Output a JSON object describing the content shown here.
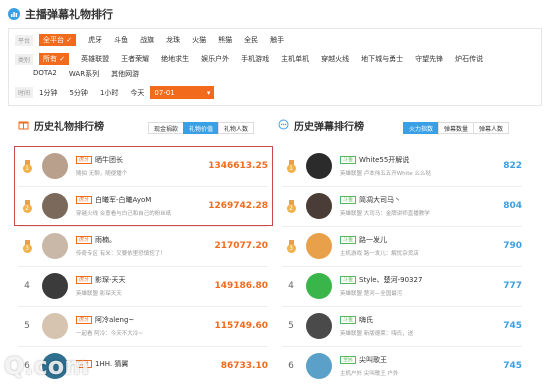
{
  "header": {
    "title": "主播弹幕礼物排行"
  },
  "filters": {
    "platform": {
      "label": "平台",
      "selected": "全平台",
      "options": [
        "虎牙",
        "斗鱼",
        "战旗",
        "龙珠",
        "火猫",
        "熊猫",
        "全民",
        "触手"
      ]
    },
    "category": {
      "label": "类别",
      "selected": "所有",
      "options": [
        "英雄联盟",
        "王者荣耀",
        "绝地求生",
        "娱乐户外",
        "手机游戏",
        "主机单机",
        "穿越火线",
        "地下城与勇士",
        "守望先锋",
        "炉石传说"
      ],
      "options_row2": [
        "DOTA2",
        "WAR系列",
        "其他网游"
      ]
    },
    "time": {
      "label": "时间",
      "options": [
        "1分钟",
        "5分钟",
        "1小时",
        "今天"
      ],
      "date": "07-01"
    }
  },
  "gift_panel": {
    "title": "历史礼物排行榜",
    "tabs": [
      "现金捐款",
      "礼物价值",
      "礼物人数"
    ],
    "active_tab": "礼物价值",
    "rows": [
      {
        "rank": "1",
        "platform": "虎牙",
        "name": "晒牛团长",
        "desc": "随拍 无聊，随便播个",
        "value": "1346613.25"
      },
      {
        "rank": "2",
        "platform": "虎牙",
        "name": "白曦军-白曦AyoM",
        "desc": "穿越火线 合意看与白己和自己的粉丝纸",
        "value": "1269742.28"
      },
      {
        "rank": "3",
        "platform": "虎牙",
        "name": "雨楠。",
        "desc": "传奇专区 有米：又要依里恐慎挖了！",
        "value": "217077.20"
      },
      {
        "rank": "4",
        "platform": "虎牙",
        "name": "影琛-天天",
        "desc": "英雄联盟 影琛天天",
        "value": "149186.80"
      },
      {
        "rank": "5",
        "platform": "虎牙",
        "name": "阿冷aleng~",
        "desc": "一起看 阿冷：今天不大冷~",
        "value": "115749.60"
      },
      {
        "rank": "6",
        "platform": "虎牙",
        "name": "1HH. 猜翼",
        "desc": "",
        "value": "86733.10"
      }
    ]
  },
  "danmu_panel": {
    "title": "历史弹幕排行榜",
    "tabs": [
      "火力指数",
      "弹幕数量",
      "弹幕人数"
    ],
    "active_tab": "火力指数",
    "rows": [
      {
        "rank": "1",
        "platform": "斗鱼",
        "name": "White55开解说",
        "desc": "英雄联盟 卢本伟五五开White 么么哒",
        "value": "822"
      },
      {
        "rank": "2",
        "platform": "斗鱼",
        "name": "简凋大司马丶",
        "desc": "英雄联盟 大司马：金牌讲师直播教学",
        "value": "804"
      },
      {
        "rank": "3",
        "platform": "斗鱼",
        "name": "路一发儿",
        "desc": "主机游戏 路一发儿：解忧杂货店",
        "value": "790"
      },
      {
        "rank": "4",
        "platform": "斗鱼",
        "name": "Style、楚河-90327",
        "desc": "英雄联盟 楚河—全国最污",
        "value": "777"
      },
      {
        "rank": "5",
        "platform": "斗鱼",
        "name": "嗨氏",
        "desc": "英雄联盟 新版德莱：嗨氏，送",
        "value": "745"
      },
      {
        "rank": "6",
        "platform": "全民",
        "name": "尖叫歌王",
        "desc": "主机户外 尖叫歌王 户外",
        "value": "745"
      }
    ]
  },
  "watermark": "Q.com"
}
